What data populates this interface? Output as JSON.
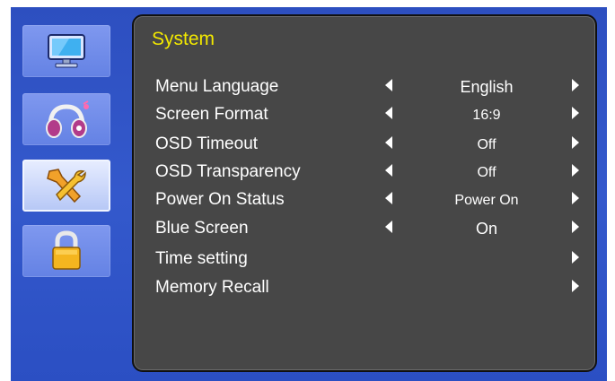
{
  "sidebar": {
    "items": [
      {
        "id": "picture",
        "icon": "monitor-icon"
      },
      {
        "id": "audio",
        "icon": "headphones-icon"
      },
      {
        "id": "system",
        "icon": "tools-icon",
        "active": true
      },
      {
        "id": "lock",
        "icon": "padlock-icon"
      }
    ]
  },
  "panel": {
    "title": "System",
    "rows": [
      {
        "label": "Menu Language",
        "value": "English"
      },
      {
        "label": "Screen Format",
        "value": "16:9"
      },
      {
        "label": "OSD Timeout",
        "value": "Off"
      },
      {
        "label": "OSD Transparency",
        "value": "Off"
      },
      {
        "label": "Power On Status",
        "value": "Power On"
      },
      {
        "label": "Blue Screen",
        "value": "On"
      },
      {
        "label": "Time setting",
        "value": ""
      },
      {
        "label": "Memory Recall",
        "value": ""
      }
    ]
  },
  "colors": {
    "background_blue": "#3459cc",
    "panel_gray": "#474747",
    "title_yellow": "#f2e800"
  }
}
